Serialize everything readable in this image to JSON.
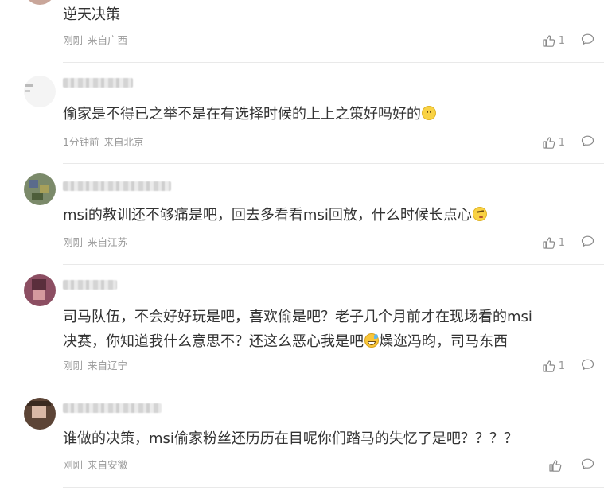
{
  "comments": [
    {
      "text": "逆天决策",
      "time": "刚刚",
      "location": "来自广西",
      "likes": "1"
    },
    {
      "text": "偷家是不得已之举不是在有选择时候的上上之策好吗好的",
      "emoji": "smile-emoji",
      "time": "1分钟前",
      "location": "来自北京",
      "likes": "1"
    },
    {
      "text": "msi的教训还不够痛是吧，回去多看看msi回放，什么时候长点心",
      "emoji": "thinking-emoji",
      "time": "刚刚",
      "location": "来自江苏",
      "likes": "1"
    },
    {
      "text_line1": "司马队伍，不会好好玩是吧，喜欢偷是吧？老子几个月前才在现场看的msi",
      "text_line2a": "决赛，你知道我什么意思不？还这么恶心我是吧",
      "emoji": "sweat-smile-emoji",
      "text_line2b": "燥迩冯昀，司马东西",
      "time": "刚刚",
      "location": "来自辽宁",
      "likes": "1"
    },
    {
      "text": "谁做的决策，msi偷家粉丝还历历在目呢你们踏马的失忆了是吧？？？？",
      "time": "刚刚",
      "location": "来自安徽",
      "likes": ""
    }
  ],
  "icons": {
    "like": "thumbs-up-icon",
    "reply": "comment-bubble-icon"
  }
}
